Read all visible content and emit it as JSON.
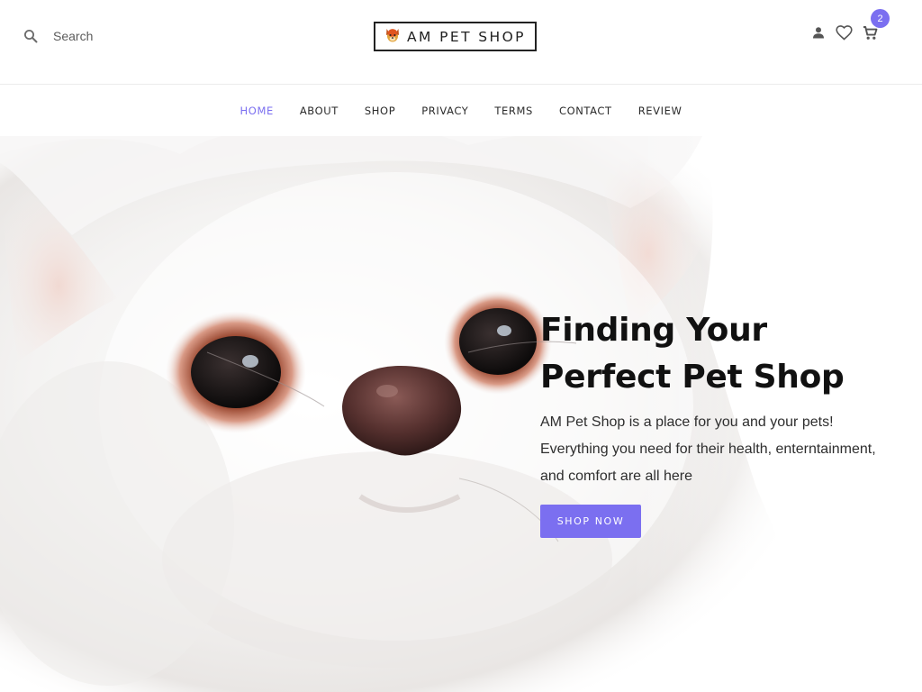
{
  "header": {
    "search": {
      "placeholder": "Search"
    },
    "logo": {
      "text": "AM PET SHOP",
      "icon": "dog-face-icon"
    },
    "actions": [
      {
        "name": "account",
        "icon": "person-icon"
      },
      {
        "name": "wishlist",
        "icon": "heart-icon"
      },
      {
        "name": "cart",
        "icon": "cart-icon",
        "badge": "2"
      }
    ]
  },
  "nav": {
    "items": [
      "HOME",
      "ABOUT",
      "SHOP",
      "PRIVACY",
      "TERMS",
      "CONTACT",
      "REVIEW"
    ],
    "active": "HOME"
  },
  "hero": {
    "title_line1": "Finding Your",
    "title_line2": "Perfect Pet Shop",
    "desc_line1": "AM Pet Shop is a place for you and your pets!",
    "desc_line2": "Everything you need for their health, enterntainment,",
    "desc_line3": "and comfort are all here",
    "cta": "SHOP NOW",
    "image": "white-pomeranian-closeup"
  },
  "colors": {
    "accent": "#7b6ff0",
    "text": "#222222",
    "background": "#ffffff"
  }
}
